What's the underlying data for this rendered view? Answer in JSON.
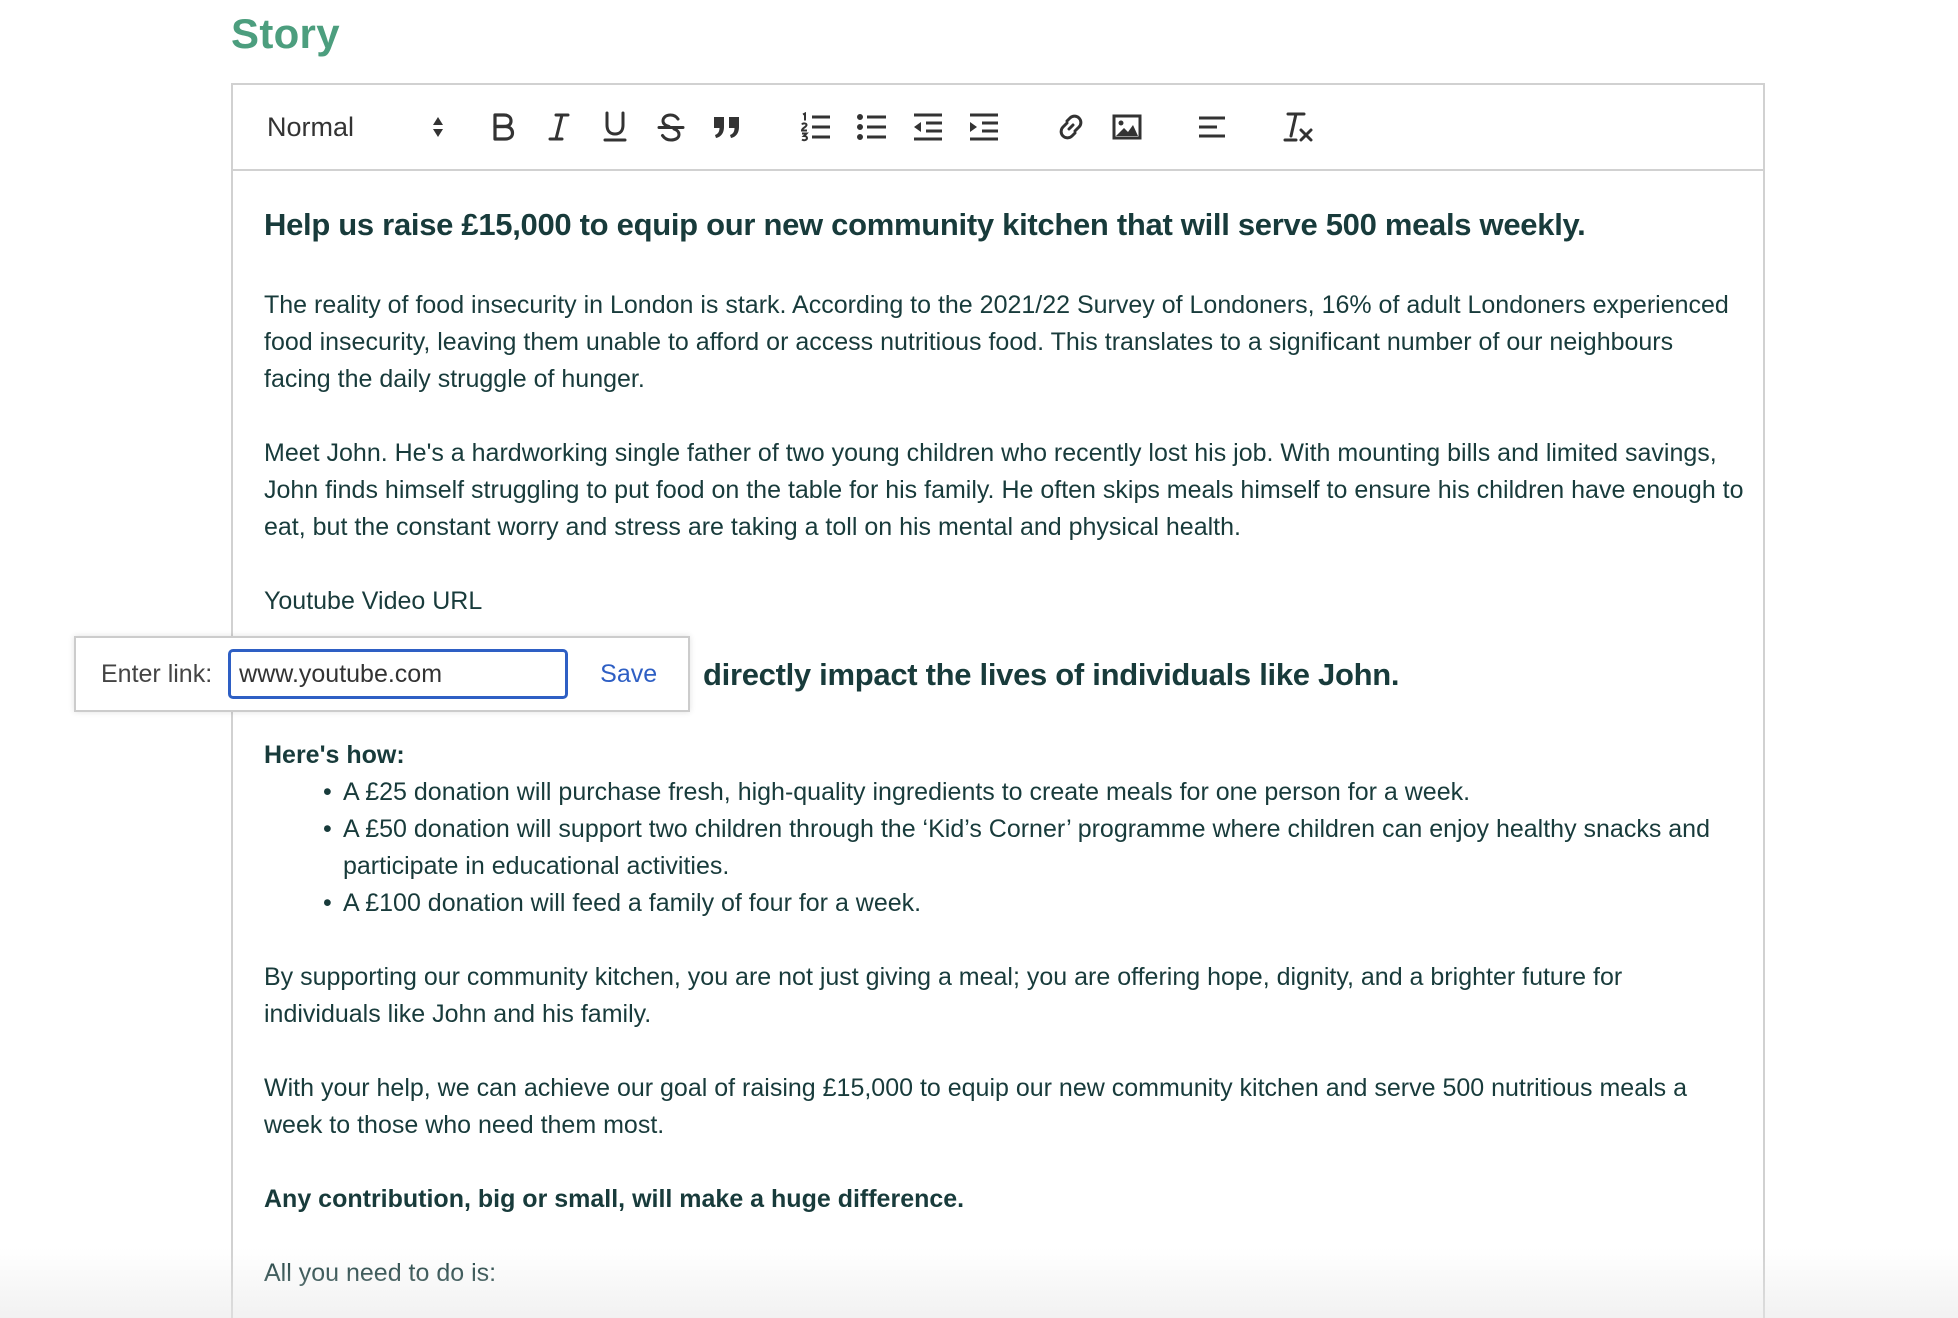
{
  "section": {
    "title": "Story"
  },
  "toolbar": {
    "heading_picker": {
      "value": "Normal",
      "icon": "up-down-arrows-icon"
    },
    "buttons": [
      {
        "name": "bold",
        "icon": "bold-icon"
      },
      {
        "name": "italic",
        "icon": "italic-icon"
      },
      {
        "name": "underline",
        "icon": "underline-icon"
      },
      {
        "name": "strike",
        "icon": "strikethrough-icon"
      },
      {
        "name": "blockquote",
        "icon": "quote-icon"
      },
      {
        "name": "ordered-list",
        "icon": "ordered-list-icon"
      },
      {
        "name": "bullet-list",
        "icon": "bullet-list-icon"
      },
      {
        "name": "outdent",
        "icon": "outdent-icon"
      },
      {
        "name": "indent",
        "icon": "indent-icon"
      },
      {
        "name": "link",
        "icon": "link-icon"
      },
      {
        "name": "image",
        "icon": "image-icon"
      },
      {
        "name": "align",
        "icon": "align-left-icon"
      },
      {
        "name": "clean",
        "icon": "clear-format-icon"
      }
    ]
  },
  "content": {
    "headline": "Help us raise £15,000 to equip our new community kitchen that will serve 500 meals weekly.",
    "para1": "The reality of food insecurity in London is stark. According to the 2021/22 Survey of Londoners, 16% of adult Londoners experienced food insecurity, leaving them unable to afford or access nutritious food. This translates to a significant number of our neighbours facing the daily struggle of hunger.",
    "para2": "Meet John. He's a hardworking single father of two young children who recently lost his job. With mounting bills and limited savings, John finds himself struggling to put food on the table for his family. He often skips meals himself to ensure his children have enough to eat, but the constant worry and stress are taking a toll on his mental and physical health.",
    "video_label": "Youtube Video URL",
    "subheadline_visible": "directly impact the lives of individuals like John.",
    "how_title": "Here's how:",
    "bullets": [
      "A £25 donation will purchase fresh, high-quality ingredients to create meals for one person for a week.",
      "A £50 donation will support two children through the ‘Kid’s Corner’ programme where children can enjoy healthy snacks and participate in educational activities.",
      "A £100 donation will feed a family of four for a week."
    ],
    "para3": "By supporting our community kitchen, you are not just giving a meal; you are offering hope, dignity, and a brighter future for individuals like John and his family.",
    "para4": "With your help, we can achieve our goal of raising £15,000 to equip our new community kitchen and serve 500 nutritious meals a week to those who need them most.",
    "para5": "Any contribution, big or small, will make a huge difference.",
    "para6": "All you need to do is:"
  },
  "link_tooltip": {
    "label": "Enter link:",
    "input_value": "www.youtube.com",
    "save_label": "Save"
  },
  "colors": {
    "title": "#4c9e7e",
    "text": "#183b3b",
    "link_accent": "#2e5fc4",
    "border": "#d1d1d1"
  }
}
